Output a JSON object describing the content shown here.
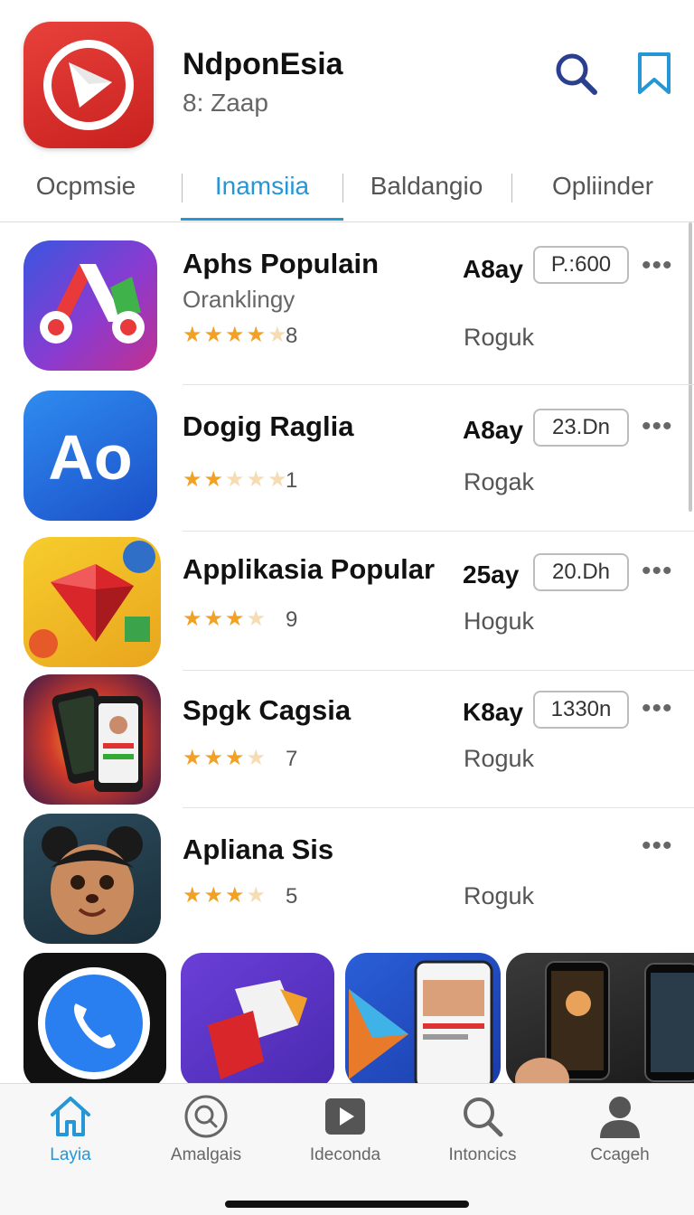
{
  "header": {
    "title": "NdponEsia",
    "subtitle": "8: Zaap",
    "accent_color": "#2596d6",
    "logo_color": "#d8302b",
    "search_icon": "search-icon",
    "bookmark_icon": "bookmark-icon"
  },
  "tabs": [
    {
      "label": "Ocpmsie",
      "active": false
    },
    {
      "label": "Inamsiia",
      "active": true
    },
    {
      "label": "Baldangio",
      "active": false
    },
    {
      "label": "Opliinder",
      "active": false
    }
  ],
  "apps": [
    {
      "name": "Aphs Populain",
      "subtitle": "Oranklingy",
      "stars": 4,
      "rating_count": "8",
      "age": "A8ay",
      "price": "P.:600",
      "action": "Roguk",
      "icon": "red-purple-shapes-icon"
    },
    {
      "name": "Dogig Raglia",
      "subtitle": "",
      "stars": 2,
      "rating_count": "1",
      "age": "A8ay",
      "price": "23.Dn",
      "action": "Rogak",
      "icon": "blue-ao-icon"
    },
    {
      "name": "Applikasia Popular",
      "subtitle": "",
      "stars": 3,
      "rating_count": "9",
      "age": "25ay",
      "price": "20.Dh",
      "action": "Hoguk",
      "icon": "red-gem-icon"
    },
    {
      "name": "Spgk Cagsia",
      "subtitle": "",
      "stars": 3,
      "rating_count": "7",
      "age": "K8ay",
      "price": "1330n",
      "action": "Roguk",
      "icon": "phones-burst-icon"
    },
    {
      "name": "Apliana Sis",
      "subtitle": "",
      "stars": 3,
      "rating_count": "5",
      "age": "",
      "price": "",
      "action": "Roguk",
      "icon": "cartoon-face-icon"
    }
  ],
  "more_label": "•••",
  "bottom_nav": [
    {
      "label": "Layia",
      "icon": "home-icon",
      "active": true
    },
    {
      "label": "Amalgais",
      "icon": "search-circle-icon",
      "active": false
    },
    {
      "label": "Ideconda",
      "icon": "play-icon",
      "active": false
    },
    {
      "label": "Intoncics",
      "icon": "search-icon",
      "active": false
    },
    {
      "label": "Ccageh",
      "icon": "person-icon",
      "active": false
    }
  ]
}
